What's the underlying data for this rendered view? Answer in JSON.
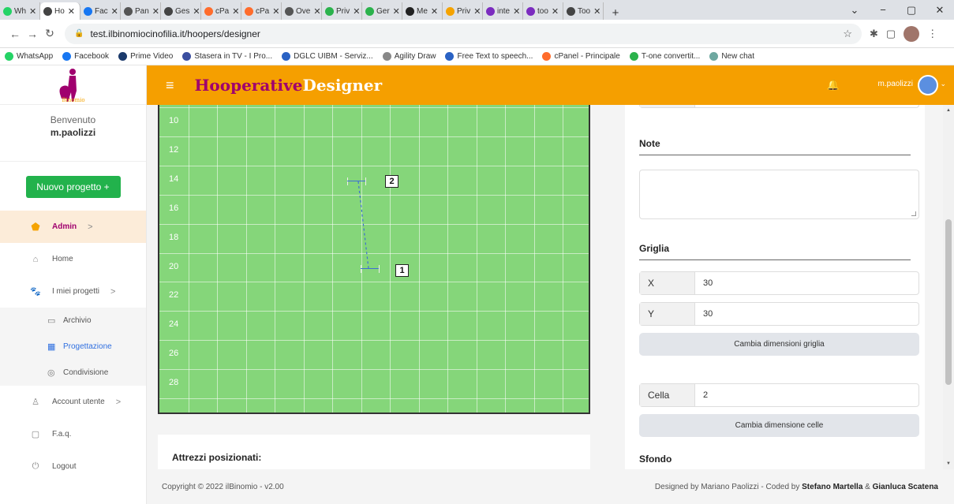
{
  "browser": {
    "tabs": [
      {
        "label": "Wh",
        "color": "#25d366"
      },
      {
        "label": "Ho",
        "color": "#444"
      },
      {
        "label": "Fac",
        "color": "#1877f2"
      },
      {
        "label": "Pan",
        "color": "#555"
      },
      {
        "label": "Ges",
        "color": "#444"
      },
      {
        "label": "cPa",
        "color": "#ff6c2c"
      },
      {
        "label": "cPa",
        "color": "#ff6c2c"
      },
      {
        "label": "Ove",
        "color": "#555"
      },
      {
        "label": "Priv",
        "color": "#2bb24c"
      },
      {
        "label": "Ger",
        "color": "#2bb24c"
      },
      {
        "label": "Me",
        "color": "#222"
      },
      {
        "label": "Priv",
        "color": "#f5a300"
      },
      {
        "label": "inte",
        "color": "#7b2cbf"
      },
      {
        "label": "too",
        "color": "#7b2cbf"
      },
      {
        "label": "Too",
        "color": "#444"
      }
    ],
    "new_tab": "+",
    "url": "test.ilbinomiocinofilia.it/hoopers/designer",
    "bookmarks": [
      {
        "label": "WhatsApp",
        "color": "#25d366"
      },
      {
        "label": "Facebook",
        "color": "#1877f2"
      },
      {
        "label": "Prime Video",
        "color": "#1b3a6b"
      },
      {
        "label": "Stasera in TV - I Pro...",
        "color": "#3b4fa0"
      },
      {
        "label": "DGLC UIBM - Serviz...",
        "color": "#2a62c4"
      },
      {
        "label": "Agility Draw",
        "color": "#888"
      },
      {
        "label": "Free Text to speech...",
        "color": "#2a62c4"
      },
      {
        "label": "cPanel - Principale",
        "color": "#ff6c2c"
      },
      {
        "label": "T-one convertit...",
        "color": "#2bb24c"
      },
      {
        "label": "New chat",
        "color": "#6ea8a0"
      }
    ]
  },
  "sidebar": {
    "welcome": "Benvenuto",
    "username": "m.paolizzi",
    "new_project": "Nuovo progetto +",
    "items": [
      {
        "label": "Admin",
        "icon": "shield-icon",
        "arrow": ">"
      },
      {
        "label": "Home",
        "icon": "home-icon"
      },
      {
        "label": "I miei progetti",
        "icon": "paw-icon",
        "arrow": ">"
      }
    ],
    "subitems": [
      {
        "label": "Archivio",
        "icon": "archive-icon"
      },
      {
        "label": "Progettazione",
        "icon": "design-icon"
      },
      {
        "label": "Condivisione",
        "icon": "share-icon"
      }
    ],
    "bottom_items": [
      {
        "label": "Account utente",
        "icon": "user-icon",
        "arrow": ">"
      },
      {
        "label": "F.a.q.",
        "icon": "faq-icon"
      },
      {
        "label": "Logout",
        "icon": "power-icon"
      }
    ]
  },
  "topbar": {
    "brand_part1": "Hooperative",
    "brand_part2": "Designer",
    "username": "m.paolizzi"
  },
  "grid": {
    "row_labels": [
      "10",
      "12",
      "14",
      "16",
      "18",
      "20",
      "22",
      "24",
      "26",
      "28"
    ],
    "fixtures": [
      {
        "number": "2"
      },
      {
        "number": "1"
      }
    ]
  },
  "attrezzi_title": "Attrezzi posizionati:",
  "panel": {
    "note_title": "Note",
    "grid_title": "Griglia",
    "x_label": "X",
    "x_value": "30",
    "y_label": "Y",
    "y_value": "30",
    "change_grid_button": "Cambia dimensioni griglia",
    "cell_label": "Cella",
    "cell_value": "2",
    "change_cell_button": "Cambia dimensione celle",
    "background_title": "Sfondo"
  },
  "footer": {
    "copyright": "Copyright © 2022 ilBinomio - v2.00",
    "credits_prefix": "Designed by Mariano Paolizzi - Coded by",
    "author1": "Stefano Martella",
    "amp": "&",
    "author2": "Gianluca Scatena"
  }
}
